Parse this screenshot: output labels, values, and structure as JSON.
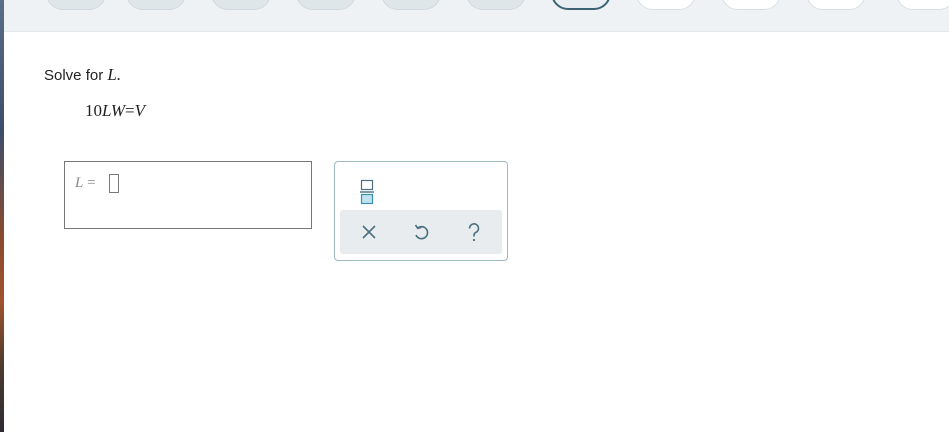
{
  "problem": {
    "instruction": "Solve for",
    "target_variable": "L",
    "period": ".",
    "equation": {
      "coefficient": "10",
      "lhs_vars": "LW",
      "equals": "=",
      "rhs": "V"
    }
  },
  "answer": {
    "variable": "L",
    "equals": "="
  },
  "tools": {
    "fraction": "fraction-template-icon",
    "clear": "close-icon",
    "undo": "undo-icon",
    "help": "help-icon"
  },
  "colors": {
    "accent": "#3d8fb0",
    "icon": "#4a6f80",
    "current_question_border": "#3d6272"
  }
}
